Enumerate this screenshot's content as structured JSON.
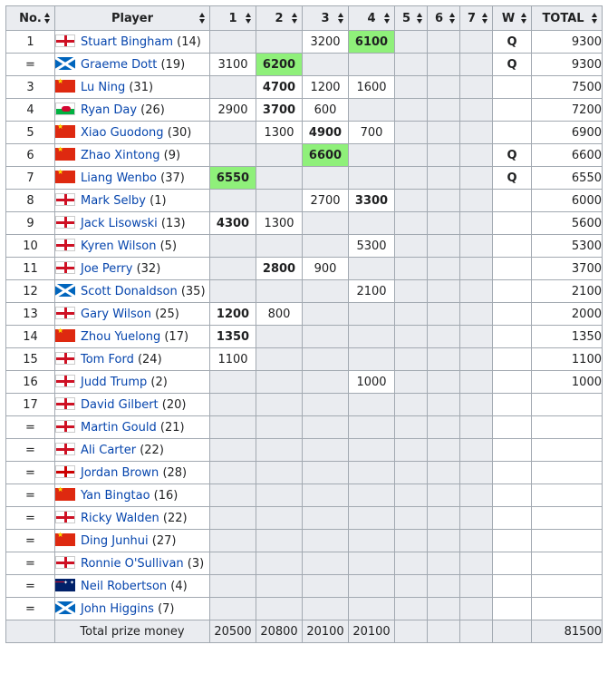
{
  "headers": {
    "no": "No.",
    "player": "Player",
    "events": [
      "1",
      "2",
      "3",
      "4",
      "5",
      "6",
      "7"
    ],
    "w": "W",
    "total": "TOTAL"
  },
  "rows": [
    {
      "no": "1",
      "flag": "england-flag-icon",
      "name": "Stuart Bingham",
      "seed": "(14)",
      "cells": [
        "",
        "",
        "3200",
        "6100",
        "",
        "",
        ""
      ],
      "w": "Q",
      "total": "9300"
    },
    {
      "no": "=",
      "flag": "scotland-flag-icon",
      "name": "Graeme Dott",
      "seed": "(19)",
      "cells": [
        "3100",
        "6200",
        "",
        "",
        "",
        "",
        ""
      ],
      "w": "Q",
      "total": "9300"
    },
    {
      "no": "3",
      "flag": "china-flag-icon",
      "name": "Lu Ning",
      "seed": "(31)",
      "cells": [
        "",
        "4700",
        "1200",
        "1600",
        "",
        "",
        ""
      ],
      "w": "",
      "total": "7500"
    },
    {
      "no": "4",
      "flag": "wales-flag-icon",
      "name": "Ryan Day",
      "seed": "(26)",
      "cells": [
        "2900",
        "3700",
        "600",
        "",
        "",
        "",
        ""
      ],
      "w": "",
      "total": "7200"
    },
    {
      "no": "5",
      "flag": "china-flag-icon",
      "name": "Xiao Guodong",
      "seed": "(30)",
      "cells": [
        "",
        "1300",
        "4900",
        "700",
        "",
        "",
        ""
      ],
      "w": "",
      "total": "6900"
    },
    {
      "no": "6",
      "flag": "china-flag-icon",
      "name": "Zhao Xintong",
      "seed": "(9)",
      "cells": [
        "",
        "",
        "6600",
        "",
        "",
        "",
        ""
      ],
      "w": "Q",
      "total": "6600"
    },
    {
      "no": "7",
      "flag": "china-flag-icon",
      "name": "Liang Wenbo",
      "seed": "(37)",
      "cells": [
        "6550",
        "",
        "",
        "",
        "",
        "",
        ""
      ],
      "w": "Q",
      "total": "6550"
    },
    {
      "no": "8",
      "flag": "england-flag-icon",
      "name": "Mark Selby",
      "seed": "(1)",
      "cells": [
        "",
        "",
        "2700",
        "3300",
        "",
        "",
        ""
      ],
      "w": "",
      "total": "6000"
    },
    {
      "no": "9",
      "flag": "england-flag-icon",
      "name": "Jack Lisowski",
      "seed": "(13)",
      "cells": [
        "4300",
        "1300",
        "",
        "",
        "",
        "",
        ""
      ],
      "w": "",
      "total": "5600"
    },
    {
      "no": "10",
      "flag": "england-flag-icon",
      "name": "Kyren Wilson",
      "seed": "(5)",
      "cells": [
        "",
        "",
        "",
        "5300",
        "",
        "",
        ""
      ],
      "w": "",
      "total": "5300"
    },
    {
      "no": "11",
      "flag": "england-flag-icon",
      "name": "Joe Perry",
      "seed": "(32)",
      "cells": [
        "",
        "2800",
        "900",
        "",
        "",
        "",
        ""
      ],
      "w": "",
      "total": "3700"
    },
    {
      "no": "12",
      "flag": "scotland-flag-icon",
      "name": "Scott Donaldson",
      "seed": "(35)",
      "cells": [
        "",
        "",
        "",
        "2100",
        "",
        "",
        ""
      ],
      "w": "",
      "total": "2100"
    },
    {
      "no": "13",
      "flag": "england-flag-icon",
      "name": "Gary Wilson",
      "seed": "(25)",
      "cells": [
        "1200",
        "800",
        "",
        "",
        "",
        "",
        ""
      ],
      "w": "",
      "total": "2000"
    },
    {
      "no": "14",
      "flag": "china-flag-icon",
      "name": "Zhou Yuelong",
      "seed": "(17)",
      "cells": [
        "1350",
        "",
        "",
        "",
        "",
        "",
        ""
      ],
      "w": "",
      "total": "1350"
    },
    {
      "no": "15",
      "flag": "england-flag-icon",
      "name": "Tom Ford",
      "seed": "(24)",
      "cells": [
        "1100",
        "",
        "",
        "",
        "",
        "",
        ""
      ],
      "w": "",
      "total": "1100"
    },
    {
      "no": "16",
      "flag": "england-flag-icon",
      "name": "Judd Trump",
      "seed": "(2)",
      "cells": [
        "",
        "",
        "",
        "1000",
        "",
        "",
        ""
      ],
      "w": "",
      "total": "1000"
    },
    {
      "no": "17",
      "flag": "england-flag-icon",
      "name": "David Gilbert",
      "seed": "(20)",
      "cells": [
        "",
        "",
        "",
        "",
        "",
        "",
        ""
      ],
      "w": "",
      "total": ""
    },
    {
      "no": "=",
      "flag": "england-flag-icon",
      "name": "Martin Gould",
      "seed": "(21)",
      "cells": [
        "",
        "",
        "",
        "",
        "",
        "",
        ""
      ],
      "w": "",
      "total": ""
    },
    {
      "no": "=",
      "flag": "england-flag-icon",
      "name": "Ali Carter",
      "seed": "(22)",
      "cells": [
        "",
        "",
        "",
        "",
        "",
        "",
        ""
      ],
      "w": "",
      "total": ""
    },
    {
      "no": "=",
      "flag": "northern-ireland-flag-icon",
      "name": "Jordan Brown",
      "seed": "(28)",
      "cells": [
        "",
        "",
        "",
        "",
        "",
        "",
        ""
      ],
      "w": "",
      "total": ""
    },
    {
      "no": "=",
      "flag": "china-flag-icon",
      "name": "Yan Bingtao",
      "seed": "(16)",
      "cells": [
        "",
        "",
        "",
        "",
        "",
        "",
        ""
      ],
      "w": "",
      "total": ""
    },
    {
      "no": "=",
      "flag": "england-flag-icon",
      "name": "Ricky Walden",
      "seed": "(22)",
      "cells": [
        "",
        "",
        "",
        "",
        "",
        "",
        ""
      ],
      "w": "",
      "total": ""
    },
    {
      "no": "=",
      "flag": "china-flag-icon",
      "name": "Ding Junhui",
      "seed": "(27)",
      "cells": [
        "",
        "",
        "",
        "",
        "",
        "",
        ""
      ],
      "w": "",
      "total": ""
    },
    {
      "no": "=",
      "flag": "england-flag-icon",
      "name": "Ronnie O'Sullivan",
      "seed": "(3)",
      "cells": [
        "",
        "",
        "",
        "",
        "",
        "",
        ""
      ],
      "w": "",
      "total": ""
    },
    {
      "no": "=",
      "flag": "australia-flag-icon",
      "name": "Neil Robertson",
      "seed": "(4)",
      "cells": [
        "",
        "",
        "",
        "",
        "",
        "",
        ""
      ],
      "w": "",
      "total": ""
    },
    {
      "no": "=",
      "flag": "scotland-flag-icon",
      "name": "John Higgins",
      "seed": "(7)",
      "cells": [
        "",
        "",
        "",
        "",
        "",
        "",
        ""
      ],
      "w": "",
      "total": ""
    }
  ],
  "footer": {
    "label": "Total prize money",
    "cells": [
      "20500",
      "20800",
      "20100",
      "20100",
      "",
      "",
      ""
    ],
    "w": "",
    "total": "81500"
  },
  "colors": {
    "header_bg": "#eaecf0",
    "shade": "#eaecf0",
    "highlight_green": "#8ff07a",
    "link": "#0645ad",
    "border": "#a2a9b1"
  }
}
